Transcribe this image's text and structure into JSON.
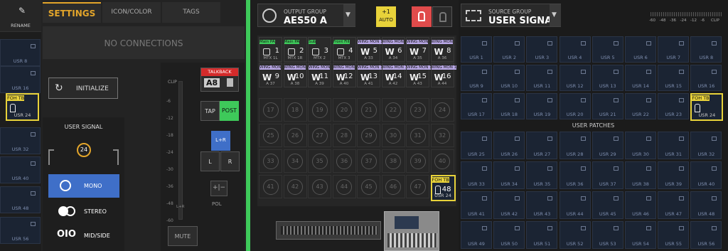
{
  "left_usr_labels": [
    "USR 8",
    "USR 16",
    "USR 24",
    "USR 32",
    "USR 40",
    "USR 48",
    "USR 56"
  ],
  "rename": "RENAME",
  "tabs": [
    "SETTINGS",
    "ICON/COLOR",
    "TAGS"
  ],
  "no_connections": "NO CONNECTIONS",
  "initialize": "INITIALIZE",
  "user_signal": "USER SIGNAL",
  "badge_num": "24",
  "modes": [
    "MONO",
    "STEREO",
    "MID/SIDE"
  ],
  "clip": "CLIP",
  "meter_scale": [
    "-6",
    "-12",
    "-18",
    "-24",
    "-30",
    "-36",
    "-48",
    "-60"
  ],
  "lr_small": "L+R",
  "talkback": "TALKBACK",
  "talkback_src": "A8",
  "tap": "TAP",
  "post": "POST",
  "lr_btn": "L+R",
  "l_btn": "L",
  "r_btn": "R",
  "pol": "POL",
  "mute": "MUTE",
  "output_group_label": "OUTPUT GROUP",
  "output_group_value": "AES50 A",
  "auto_top": "+1",
  "auto_bot": "AUTO",
  "outputs": [
    {
      "hd": "Main PA",
      "n": "1",
      "sub": "MTX 1L",
      "col": "#3ec95a",
      "w": false
    },
    {
      "hd": "Main PA",
      "n": "2",
      "sub": "MTX 1R",
      "col": "#3ec95a",
      "w": false
    },
    {
      "hd": "Sub",
      "n": "3",
      "sub": "MTX 2",
      "col": "#3ec95a",
      "w": false
    },
    {
      "hd": "Front Fill",
      "n": "4",
      "sub": "MTX 3",
      "col": "#3ec95a",
      "w": false
    },
    {
      "hd": "WING MON 1",
      "n": "5",
      "sub": "A 33",
      "col": "#b9a8e6",
      "w": true
    },
    {
      "hd": "WING MON",
      "n": "6",
      "sub": "A 34",
      "col": "#b9a8e6",
      "w": true
    },
    {
      "hd": "WING MON",
      "n": "7",
      "sub": "A 35",
      "col": "#b9a8e6",
      "w": true
    },
    {
      "hd": "WING MON",
      "n": "8",
      "sub": "A 36",
      "col": "#b9a8e6",
      "w": true
    },
    {
      "hd": "WING MON",
      "n": "9",
      "sub": "A 37",
      "col": "#b9a8e6",
      "w": true
    },
    {
      "hd": "WING MON",
      "n": "10",
      "sub": "A 38",
      "col": "#b9a8e6",
      "w": true
    },
    {
      "hd": "WING MON",
      "n": "11",
      "sub": "A 39",
      "col": "#b9a8e6",
      "w": true
    },
    {
      "hd": "WING MON",
      "n": "12",
      "sub": "A 40",
      "col": "#b9a8e6",
      "w": true
    },
    {
      "hd": "WING MON 1",
      "n": "13",
      "sub": "A 41",
      "col": "#b9a8e6",
      "w": true
    },
    {
      "hd": "WING MON 1",
      "n": "14",
      "sub": "A 42",
      "col": "#b9a8e6",
      "w": true
    },
    {
      "hd": "WING MON 1",
      "n": "15",
      "sub": "A 43",
      "col": "#b9a8e6",
      "w": true
    },
    {
      "hd": "WING MON 1",
      "n": "16",
      "sub": "A 44",
      "col": "#b9a8e6",
      "w": true
    }
  ],
  "empty_slots": [
    "17",
    "18",
    "19",
    "20",
    "21",
    "22",
    "23",
    "24",
    "25",
    "26",
    "27",
    "28",
    "29",
    "30",
    "31",
    "32",
    "33",
    "34",
    "35",
    "36",
    "37",
    "38",
    "39",
    "40",
    "41",
    "42",
    "43",
    "44",
    "45",
    "46",
    "47"
  ],
  "foh_tb_label": "FOH TB",
  "foh_mid_num": "48",
  "foh_usr": "USR 24",
  "source_group_label": "SOURCE GROUP",
  "source_group_value": "USER SIGNAL",
  "meter_db": [
    "-60",
    "-48",
    "-36",
    "-24",
    "-12",
    "-6",
    "CLIP"
  ],
  "user_patches": "USER PATCHES",
  "usr_top": [
    "USR 1",
    "USR 2",
    "USR 3",
    "USR 4",
    "USR 5",
    "USR 6",
    "USR 7",
    "USR 8",
    "USR 9",
    "USR 10",
    "USR 11",
    "USR 12",
    "USR 13",
    "USR 14",
    "USR 15",
    "USR 16",
    "USR 17",
    "USR 18",
    "USR 19",
    "USR 20",
    "USR 21",
    "USR 22",
    "USR 23"
  ],
  "usr_bottom": [
    "USR 25",
    "USR 26",
    "USR 27",
    "USR 28",
    "USR 29",
    "USR 30",
    "USR 31",
    "USR 32",
    "USR 33",
    "USR 34",
    "USR 35",
    "USR 36",
    "USR 37",
    "USR 38",
    "USR 39",
    "USR 40",
    "USR 41",
    "USR 42",
    "USR 43",
    "USR 44",
    "USR 45",
    "USR 46",
    "USR 47",
    "USR 48",
    "USR 49",
    "USR 50",
    "USR 51",
    "USR 52",
    "USR 53",
    "USR 54",
    "USR 55",
    "USR 56"
  ]
}
